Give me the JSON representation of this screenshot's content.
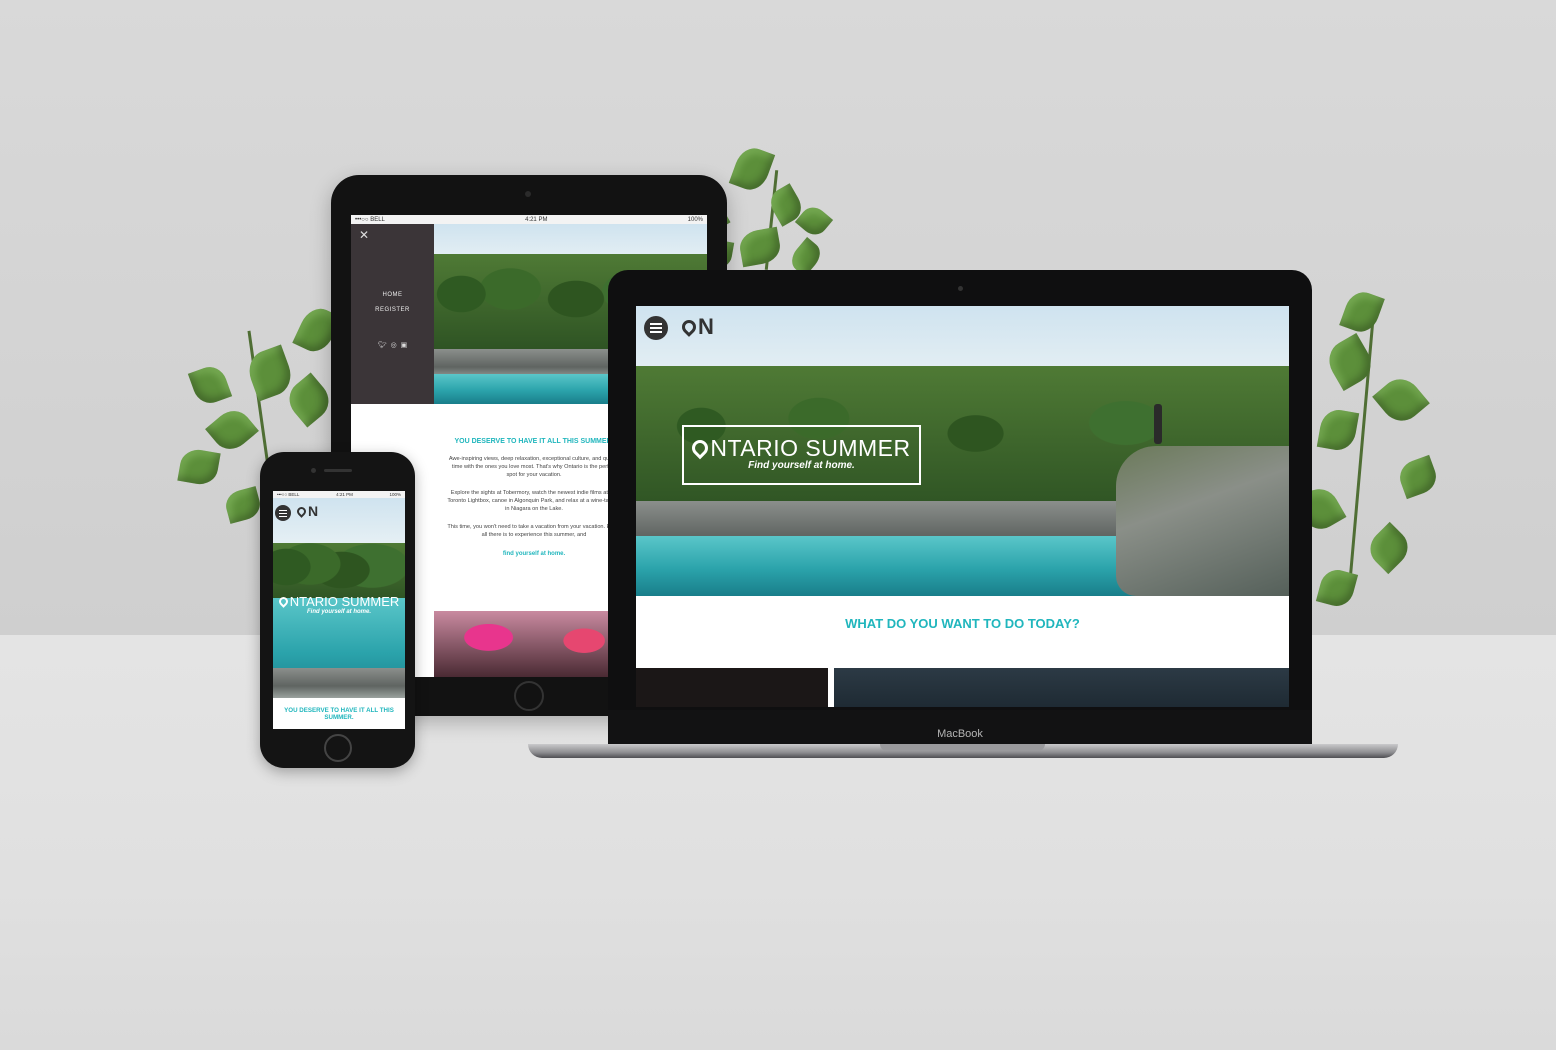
{
  "tablet": {
    "status": {
      "carrier": "•••○○ BELL",
      "time": "4:21 PM",
      "battery": "100%"
    },
    "menu": {
      "close_icon": "close-icon",
      "items": [
        "HOME",
        "REGISTER"
      ],
      "social_icons": [
        "twitter-icon",
        "instagram-icon",
        "facebook-icon"
      ]
    },
    "heading": "YOU DESERVE TO HAVE IT ALL THIS SUMMER.",
    "paragraphs": [
      "Awe-inspiring views, deep relaxation, exceptional culture, and quality time with the ones you love most. That's why Ontario is the perfect spot for your vacation.",
      "Explore the sights at Tobermory, watch the newest indie films at the Toronto Lightbox, canoe in Algonquin Park, and relax at a wine-tasting in Niagara on the Lake.",
      "This time, you won't need to take a vacation from your vacation. Enjoy all there is to experience this summer, and"
    ],
    "tagline": "find yourself at home."
  },
  "laptop": {
    "brand": "MacBook",
    "logo_text": "N",
    "hero_title": "NTARIO SUMMER",
    "hero_subtitle": "Find yourself at home.",
    "question": "WHAT DO YOU WANT TO DO TODAY?"
  },
  "phone": {
    "status": {
      "carrier": "•••○○ BELL",
      "time": "4:21 PM",
      "battery": "100%"
    },
    "logo_text": "N",
    "hero_title": "NTARIO SUMMER",
    "hero_subtitle": "Find yourself at home.",
    "caption": "YOU DESERVE TO HAVE IT ALL THIS SUMMER."
  },
  "colors": {
    "accent": "#20b6bd",
    "menu_bg": "#3b3538",
    "device": "#121212"
  }
}
